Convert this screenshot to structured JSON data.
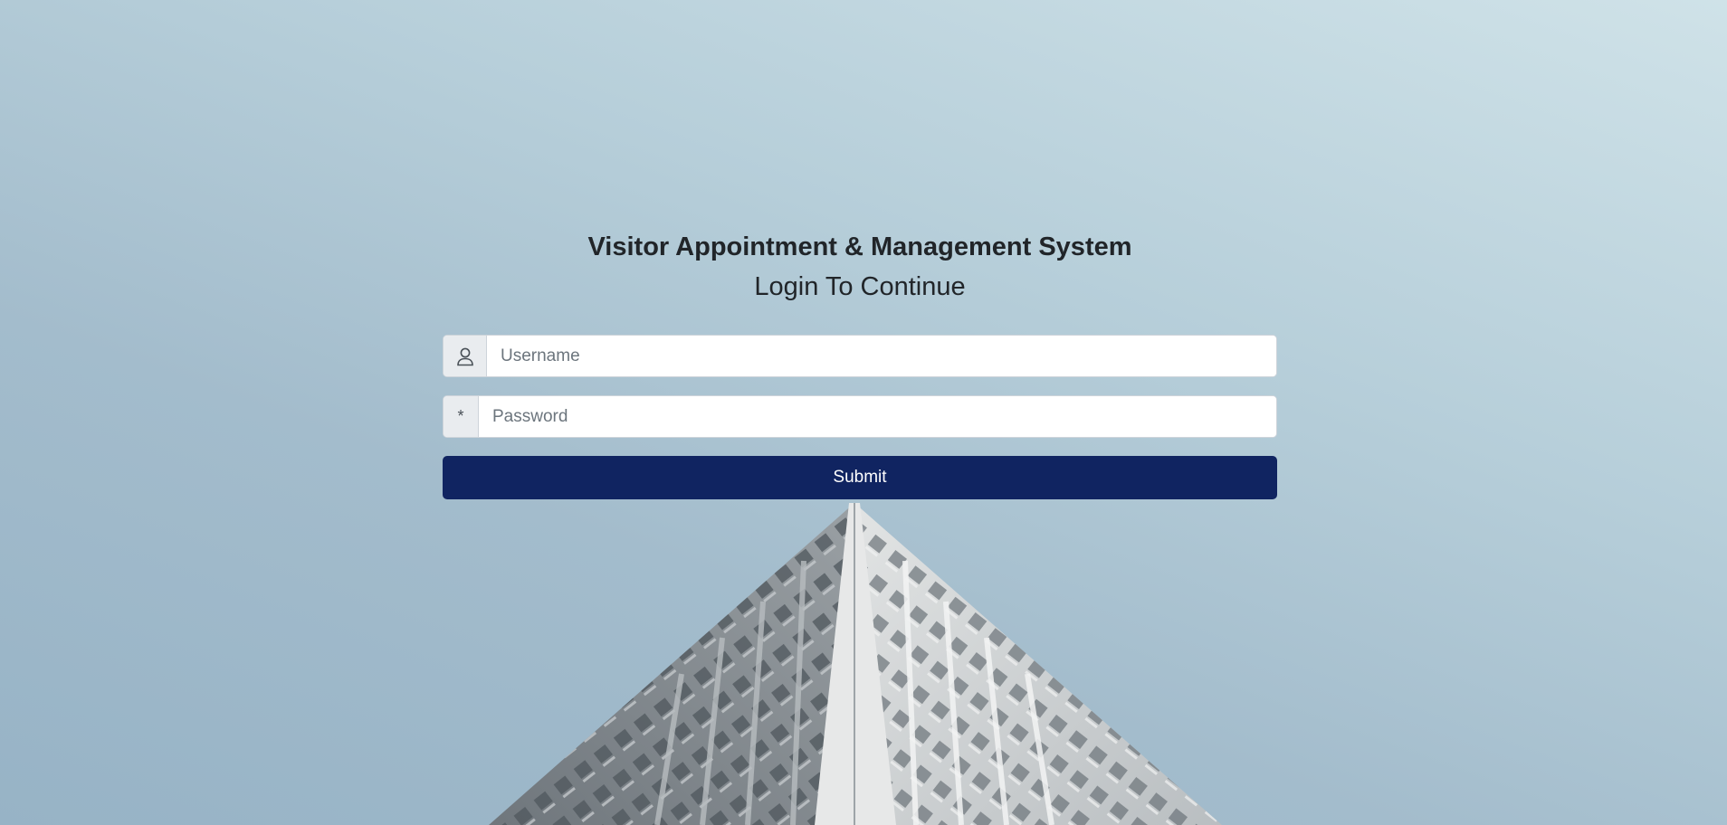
{
  "header": {
    "title": "Visitor Appointment & Management System",
    "subtitle": "Login To Continue"
  },
  "form": {
    "username": {
      "icon": "user-icon",
      "placeholder": "Username",
      "value": ""
    },
    "password": {
      "icon_glyph": "*",
      "placeholder": "Password",
      "value": ""
    },
    "submit_label": "Submit"
  },
  "colors": {
    "submit_button": "#102461",
    "sky_light": "#cfe2e8",
    "sky_dark": "#97b3c6"
  }
}
